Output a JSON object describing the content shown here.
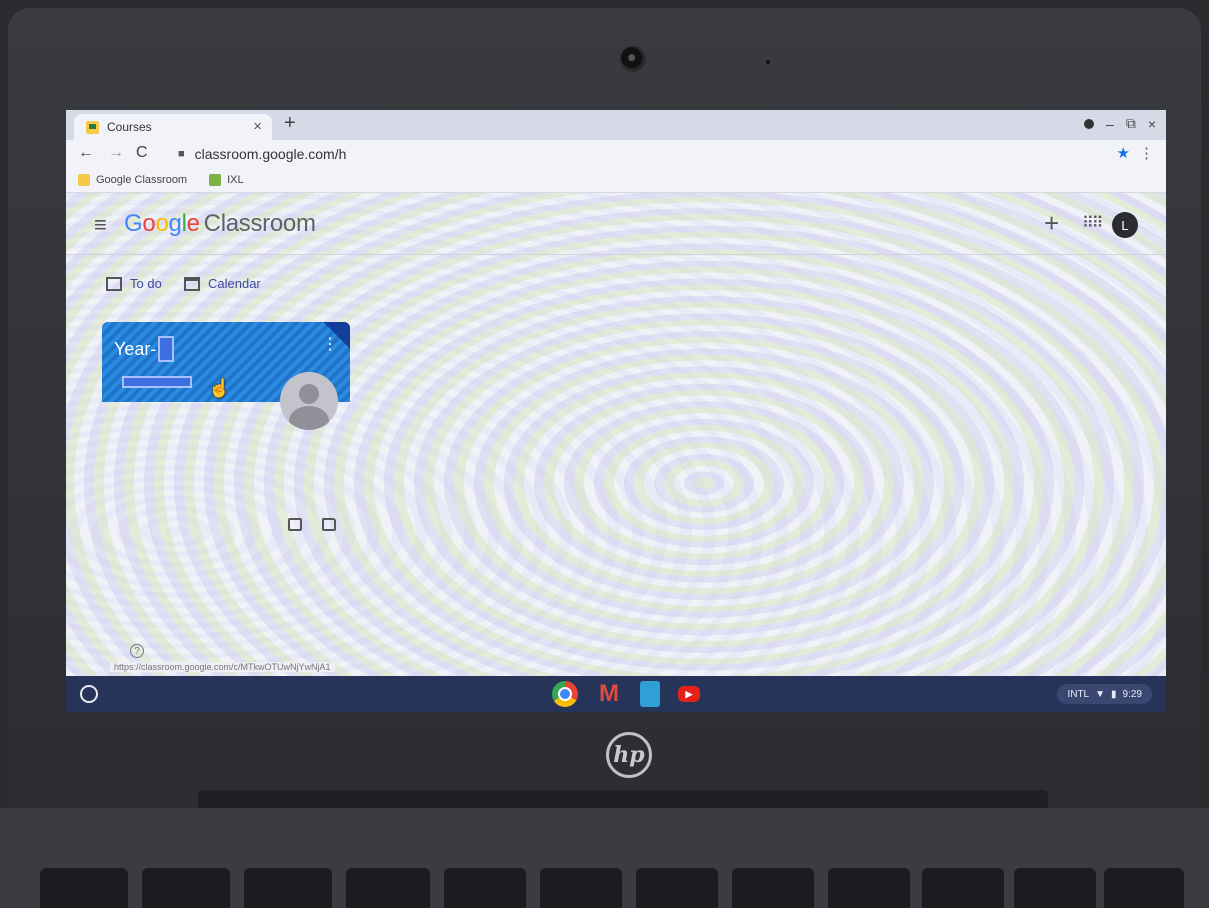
{
  "browser": {
    "tab_title": "Courses",
    "tab_close": "×",
    "new_tab": "+",
    "url": "classroom.google.com/h",
    "bookmarks": [
      {
        "label": "Google Classroom",
        "icon": "classroom-icon"
      },
      {
        "label": "IXL",
        "icon": "ixl-icon"
      }
    ],
    "window_controls": [
      "–",
      "⧉",
      "×"
    ]
  },
  "classroom": {
    "brand_google": [
      "G",
      "o",
      "o",
      "g",
      "l",
      "e"
    ],
    "brand_product": "Classroom",
    "create_label": "+",
    "avatar_letter": "L",
    "todo_label": "To do",
    "calendar_label": "Calendar",
    "course": {
      "title": "Year-"
    },
    "help_label": "?",
    "status_url": "https://classroom.google.com/c/MTkwOTUwNjYwNjA1"
  },
  "shelf": {
    "ime": "INTL",
    "time": "9:29"
  },
  "hardware": {
    "brand": "hp"
  }
}
